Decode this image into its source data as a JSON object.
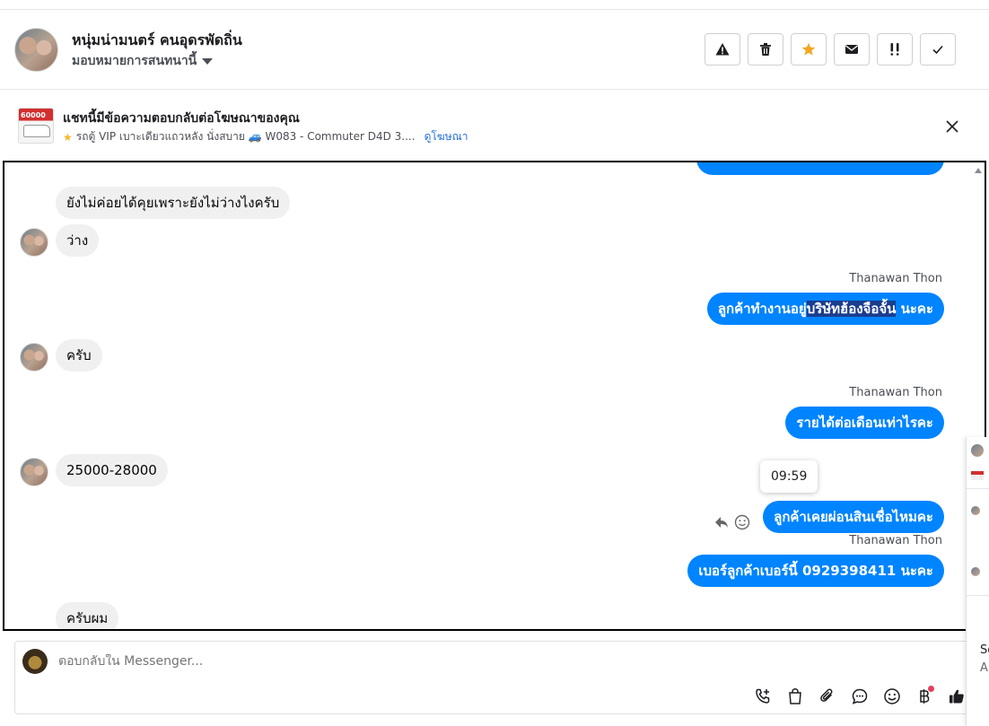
{
  "header": {
    "contact_name": "หนุ่มน่ามนตร์ คนอุดรพัดถิ่น",
    "assign_label": "มอบหมายการสนทนานี้",
    "actions": [
      "report",
      "delete",
      "star",
      "mark-unread",
      "spam",
      "done"
    ]
  },
  "ad": {
    "title": "แชทนี้มีข้อความตอบกลับต่อโฆษณาของคุณ",
    "subtitle": "รถตู้ VIP เบาะเดียวแถวหลัง นั่งสบาย 🚙 W083 - Commuter D4D 3....",
    "link": "ดูโฆษณา",
    "thumb_price": "60000"
  },
  "messages": [
    {
      "id": "m1",
      "dir": "in",
      "text": "ยังไม่ค่อยได้คุยเพราะยังไม่ว่างไงครับ"
    },
    {
      "id": "m2",
      "dir": "in",
      "text": "ว่าง"
    },
    {
      "id": "m3",
      "dir": "out",
      "sender": "Thanawan Thon",
      "text_pre": "ลูกค้าทำงานอยู่",
      "text_sel": "บริษัทฮ้องจือจั้น",
      "text_post": " นะคะ"
    },
    {
      "id": "m4",
      "dir": "in",
      "text": "ครับ"
    },
    {
      "id": "m5",
      "dir": "out",
      "sender": "Thanawan Thon",
      "text": "รายได้ต่อเดือนเท่าไรคะ"
    },
    {
      "id": "m6",
      "dir": "in",
      "text": "25000-28000"
    },
    {
      "id": "m7",
      "dir": "out",
      "text": "ลูกค้าเคยผ่อนสินเชื่อไหมคะ",
      "tooltip": "09:59"
    },
    {
      "id": "m8",
      "dir": "out",
      "sender": "Thanawan Thon",
      "text": "เบอร์ลูกค้าเบอร์นี้ 0929398411 นะคะ"
    },
    {
      "id": "m9",
      "dir": "in",
      "text": "ครับผม"
    }
  ],
  "composer": {
    "placeholder": "ตอบกลับใน Messenger..."
  },
  "side_peek": {
    "texts": [
      "Sc",
      "A"
    ]
  },
  "colors": {
    "outgoing_bubble": "#0084ff",
    "incoming_bubble": "#f0f0f0",
    "link": "#216fdb",
    "star_action": "#f5a623"
  }
}
